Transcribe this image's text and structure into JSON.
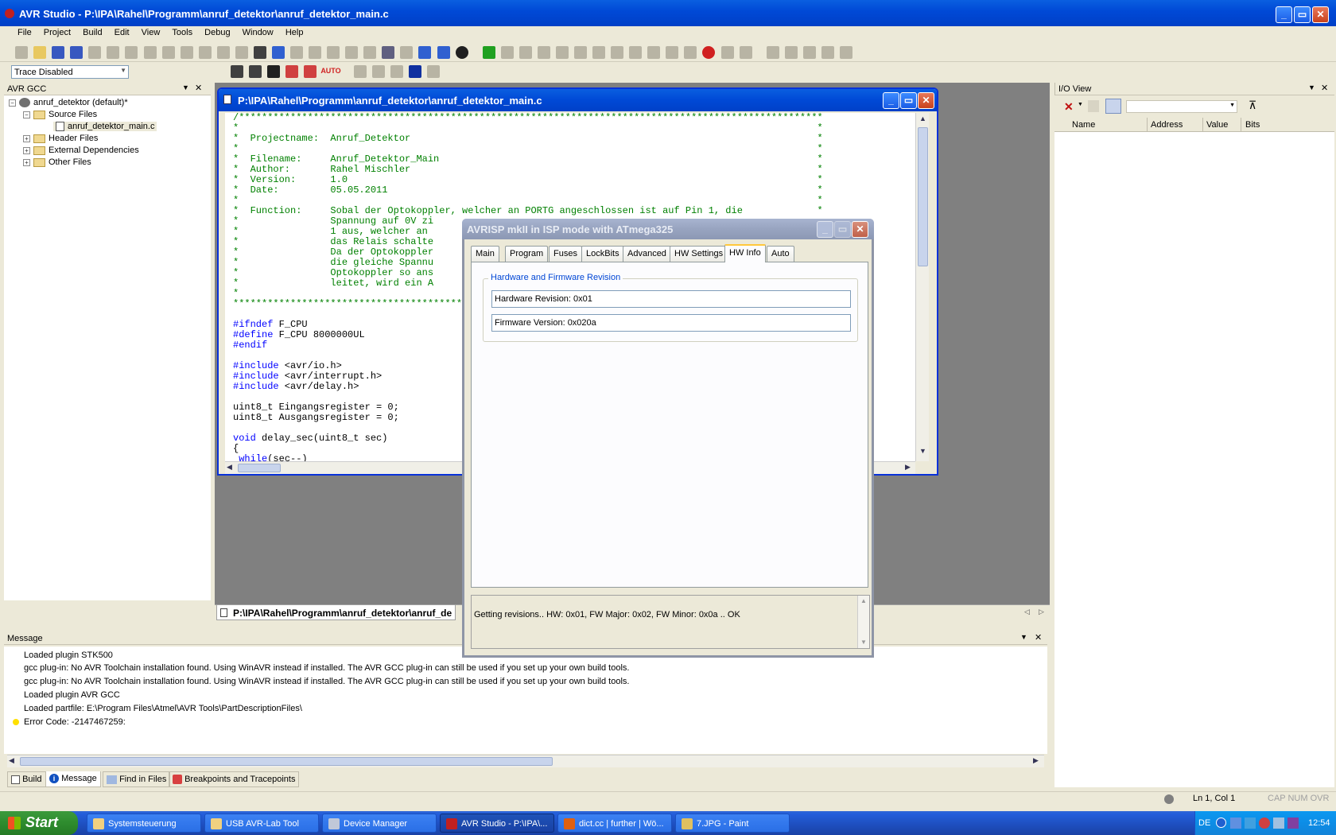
{
  "window": {
    "title": "AVR Studio - P:\\IPA\\Rahel\\Programm\\anruf_detektor\\anruf_detektor_main.c",
    "min_label": "_",
    "max_label": "▭",
    "close_label": "✕"
  },
  "menu": [
    "File",
    "Project",
    "Build",
    "Edit",
    "View",
    "Tools",
    "Debug",
    "Window",
    "Help"
  ],
  "toolbar2": {
    "trace_select": "Trace Disabled",
    "auto_label": "AUTO"
  },
  "project_panel": {
    "title": "AVR GCC",
    "root": "anruf_detektor (default)*",
    "items": [
      {
        "label": "Source Files",
        "expander": "⊟"
      },
      {
        "label": "anruf_detektor_main.c"
      },
      {
        "label": "Header Files",
        "expander": "⊞"
      },
      {
        "label": "External Dependencies",
        "expander": "⊞"
      },
      {
        "label": "Other Files",
        "expander": "⊞"
      }
    ]
  },
  "editor": {
    "title": "P:\\IPA\\Rahel\\Programm\\anruf_detektor\\anruf_detektor_main.c",
    "tab_label": "P:\\IPA\\Rahel\\Programm\\anruf_detektor\\anruf_de",
    "code_lines": [
      {
        "t": "/******************************************************************************************************",
        "c": "cm"
      },
      {
        "t": "*                                                                                                     *",
        "c": "cm"
      },
      {
        "t": "*  Projectname:  Anruf_Detektor                                                                       *",
        "c": "cm"
      },
      {
        "t": "*                                                                                                     *",
        "c": "cm"
      },
      {
        "t": "*  Filename:     Anruf_Detektor_Main                                                                  *",
        "c": "cm"
      },
      {
        "t": "*  Author:       Rahel Mischler                                                                       *",
        "c": "cm"
      },
      {
        "t": "*  Version:      1.0                                                                                  *",
        "c": "cm"
      },
      {
        "t": "*  Date:         05.05.2011                                                                           *",
        "c": "cm"
      },
      {
        "t": "*                                                                                                     *",
        "c": "cm"
      },
      {
        "t": "*  Function:     Sobal der Optokoppler, welcher an PORTG angeschlossen ist auf Pin 1, die             *",
        "c": "cm"
      },
      {
        "t": "*                Spannung auf 0V zi",
        "c": "cm"
      },
      {
        "t": "*                1 aus, welcher an",
        "c": "cm"
      },
      {
        "t": "*                das Relais schalte",
        "c": "cm"
      },
      {
        "t": "*                Da der Optokoppler",
        "c": "cm"
      },
      {
        "t": "*                die gleiche Spannu",
        "c": "cm"
      },
      {
        "t": "*                Optokoppler so ans",
        "c": "cm"
      },
      {
        "t": "*                leitet, wird ein A",
        "c": "cm"
      },
      {
        "t": "*",
        "c": "cm"
      },
      {
        "t": "******************************************",
        "c": "cm"
      },
      {
        "t": "",
        "c": ""
      },
      {
        "t": "#ifndef F_CPU",
        "c": "pp"
      },
      {
        "t": "#define F_CPU 8000000UL",
        "c": "pp"
      },
      {
        "t": "#endif",
        "c": "pp"
      },
      {
        "t": "",
        "c": ""
      },
      {
        "t": "#include <avr/io.h>",
        "c": "pp"
      },
      {
        "t": "#include <avr/interrupt.h>",
        "c": "pp"
      },
      {
        "t": "#include <avr/delay.h>",
        "c": "pp"
      },
      {
        "t": "",
        "c": ""
      },
      {
        "t": "uint8_t Eingangsregister = 0;",
        "c": ""
      },
      {
        "t": "uint8_t Ausgangsregister = 0;",
        "c": ""
      },
      {
        "t": "",
        "c": ""
      },
      {
        "t": "void delay_sec(uint8_t sec)",
        "c": "fn"
      },
      {
        "t": "{",
        "c": ""
      },
      {
        "t": " while(sec--)",
        "c": "wh"
      }
    ]
  },
  "dialog": {
    "title": "AVRISP mkII in ISP mode with ATmega325",
    "tabs": [
      "Main",
      "Program",
      "Fuses",
      "LockBits",
      "Advanced",
      "HW Settings",
      "HW Info",
      "Auto"
    ],
    "active_tab": "HW Info",
    "group_title": "Hardware and Firmware Revision",
    "hw_revision": "Hardware Revision: 0x01",
    "fw_version": "Firmware Version: 0x020a",
    "status": "Getting revisions.. HW: 0x01, FW Major: 0x02, FW Minor: 0x0a .. OK"
  },
  "io_view": {
    "title": "I/O View",
    "columns": [
      "Name",
      "Address",
      "Value",
      "Bits"
    ]
  },
  "message_panel": {
    "title": "Message",
    "lines": [
      "Loaded plugin STK500",
      "gcc plug-in: No AVR Toolchain installation found. Using WinAVR instead if installed. The AVR GCC plug-in can still be used if you set up your own build tools.",
      "gcc plug-in: No AVR Toolchain installation found. Using WinAVR instead if installed. The AVR GCC plug-in can still be used if you set up your own build tools.",
      "Loaded plugin AVR GCC",
      "Loaded partfile: E:\\Program Files\\Atmel\\AVR Tools\\PartDescriptionFiles\\",
      "Error Code: -2147467259:"
    ],
    "tabs": [
      "Build",
      "Message",
      "Find in Files",
      "Breakpoints and Tracepoints"
    ],
    "active_tab": "Message"
  },
  "statusbar": {
    "position": "Ln 1, Col 1",
    "indicators": "CAP  NUM  OVR"
  },
  "taskbar": {
    "start": "Start",
    "tasks": [
      {
        "label": "Systemsteuerung",
        "icon_color": "#f0d080"
      },
      {
        "label": "USB AVR-Lab Tool",
        "icon_color": "#f0d080"
      },
      {
        "label": "Device Manager",
        "icon_color": "#c0c8d8"
      },
      {
        "label": "AVR Studio - P:\\IPA\\...",
        "icon_color": "#c02020"
      },
      {
        "label": "dict.cc | further | Wö...",
        "icon_color": "#e06010"
      },
      {
        "label": "7.JPG - Paint",
        "icon_color": "#e0c060"
      }
    ],
    "active_task": 3,
    "lang": "DE",
    "clock": "12:54"
  },
  "colors": {
    "xp_blue": "#0054e3",
    "comment_green": "#008000",
    "preproc_blue": "#0000ff",
    "inactive_title": "#9aa6c2",
    "error_dot": "#ffe000"
  }
}
